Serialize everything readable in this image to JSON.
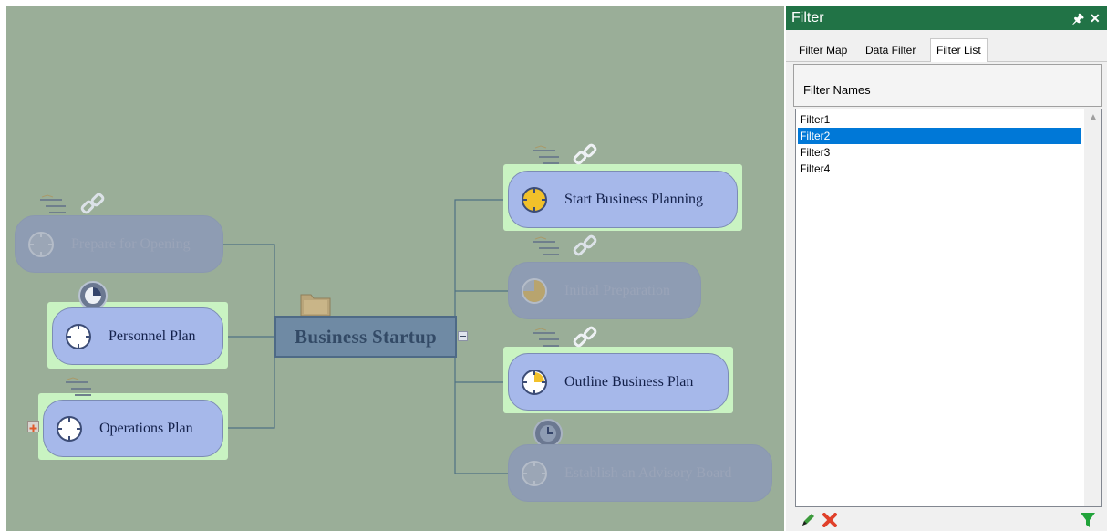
{
  "map": {
    "central": {
      "label": "Business Startup"
    },
    "left_nodes": [
      {
        "label": "Prepare for Opening"
      },
      {
        "label": "Personnel Plan"
      },
      {
        "label": "Operations Plan"
      }
    ],
    "right_nodes": [
      {
        "label": "Start Business Planning"
      },
      {
        "label": "Initial Preparation"
      },
      {
        "label": "Outline Business Plan"
      },
      {
        "label": "Establish an Advisory Board"
      }
    ],
    "icons": [
      "folder-icon",
      "task-icon",
      "link-icon",
      "clock-icon",
      "progress-icon",
      "expand-icon",
      "collapse-icon"
    ],
    "colors": {
      "canvas": "#9aae98",
      "highlight": "#c9f3c2",
      "active_node": "#a6b8ea",
      "faded_node": "#8e9cb3",
      "central": "#6f8aa4"
    }
  },
  "panel": {
    "title": "Filter",
    "pin_icon": "pin-icon",
    "close_icon": "close-icon",
    "tabs": [
      {
        "label": "Filter Map"
      },
      {
        "label": "Data Filter"
      },
      {
        "label": "Filter List",
        "selected": true
      }
    ],
    "section_header": "Filter Names",
    "filters": [
      {
        "label": "Filter1"
      },
      {
        "label": "Filter2",
        "selected": true
      },
      {
        "label": "Filter3"
      },
      {
        "label": "Filter4"
      }
    ],
    "toolbar": [
      "edit-icon",
      "delete-icon",
      "apply-filter-icon"
    ],
    "colors": {
      "title_bar": "#217346",
      "selection": "#0078d7"
    }
  }
}
